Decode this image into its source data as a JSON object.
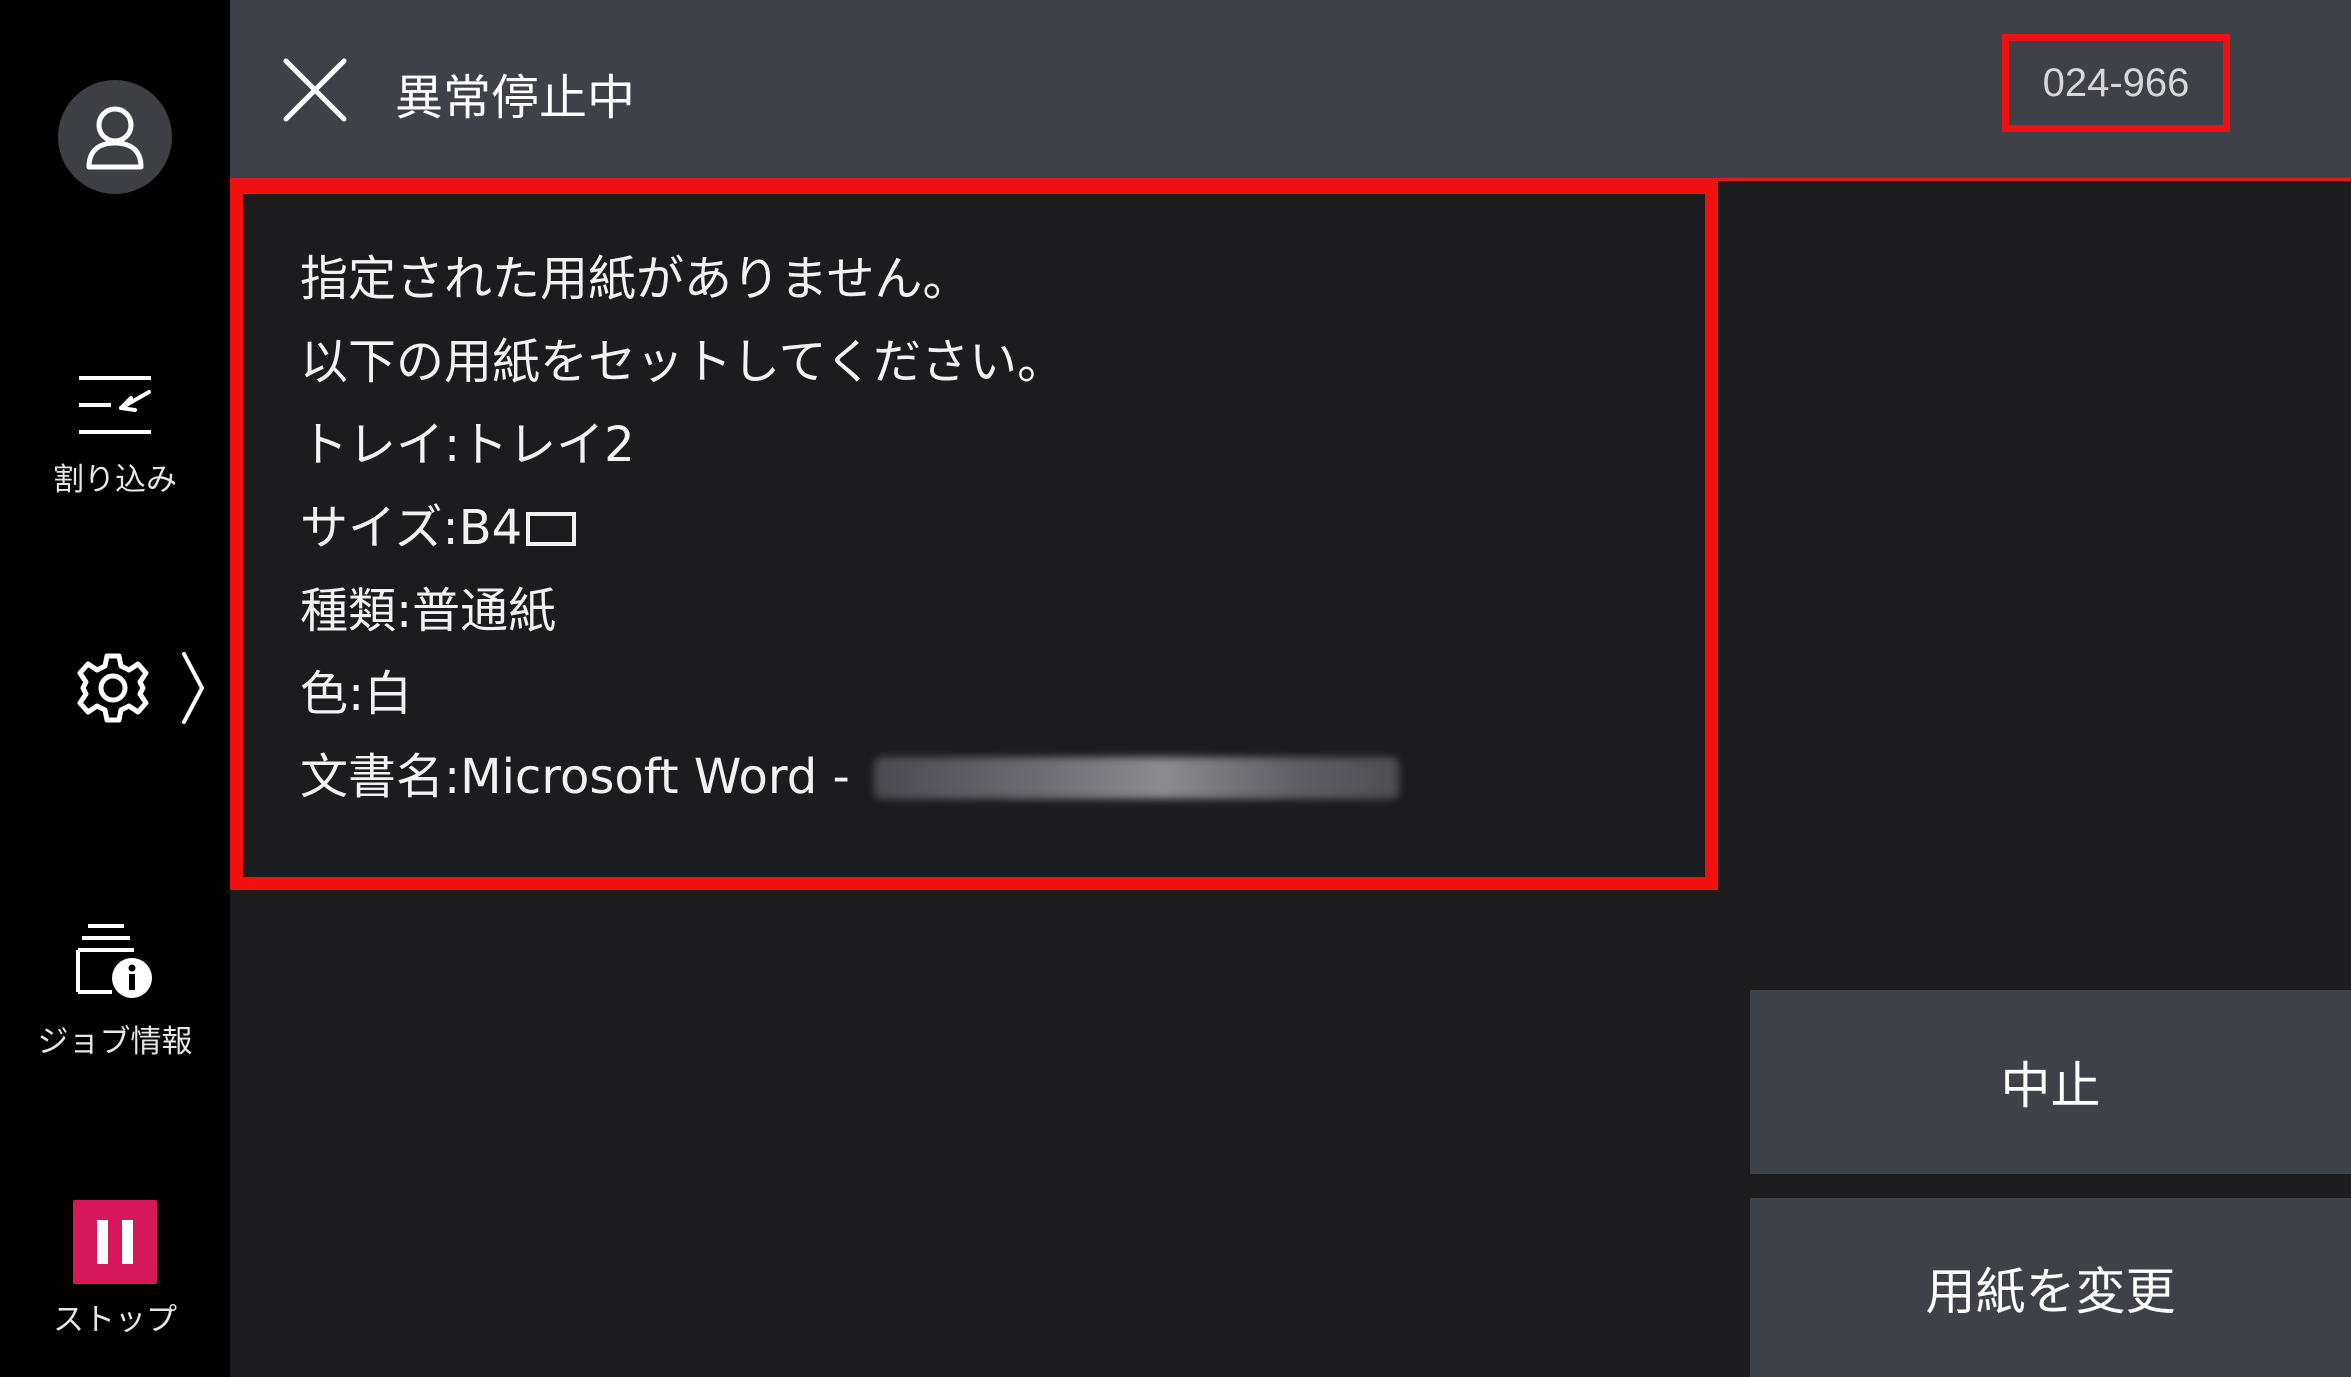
{
  "header": {
    "title": "異常停止中",
    "error_code": "024-966"
  },
  "sidebar": {
    "interrupt_label": "割り込み",
    "job_info_label": "ジョブ情報",
    "stop_label": "ストップ"
  },
  "message": {
    "line1": "指定された用紙がありません。",
    "line2": "以下の用紙をセットしてください。",
    "tray": "トレイ:トレイ2",
    "size": "サイズ:B4",
    "type": "種類:普通紙",
    "color": "色:白",
    "document": "文書名:Microsoft Word -"
  },
  "actions": {
    "cancel_label": "中止",
    "change_paper_label": "用紙を変更"
  },
  "colors": {
    "background": "#1c1c1f",
    "header": "#3f4148",
    "highlight_red": "#f20f0f",
    "stop_pink": "#d6175a"
  }
}
